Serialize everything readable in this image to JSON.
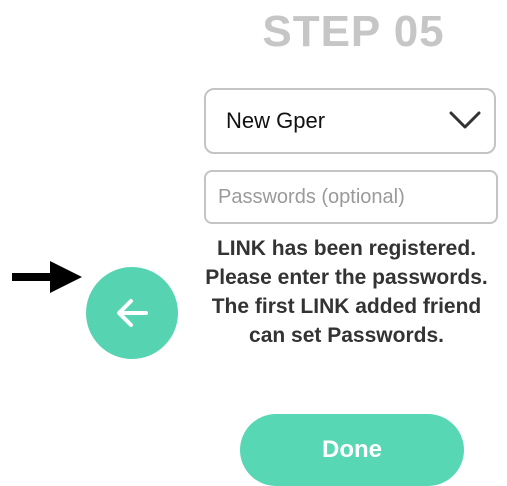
{
  "header": {
    "title": "STEP 05"
  },
  "form": {
    "select": {
      "selected_value": "New Gper",
      "icon": "chevron-down-icon"
    },
    "password": {
      "placeholder": "Passwords (optional)",
      "value": ""
    }
  },
  "message": {
    "lines": [
      "LINK has been registered.",
      "Please enter the passwords.",
      "The first LINK added friend",
      "can set Passwords."
    ]
  },
  "navigation": {
    "back_icon": "arrow-left-icon",
    "indicator_icon": "arrow-right-icon"
  },
  "actions": {
    "done_label": "Done"
  },
  "colors": {
    "accent": "#56d4b2",
    "title": "#c6c6c6",
    "text": "#333333",
    "border": "#c4c4c4"
  }
}
